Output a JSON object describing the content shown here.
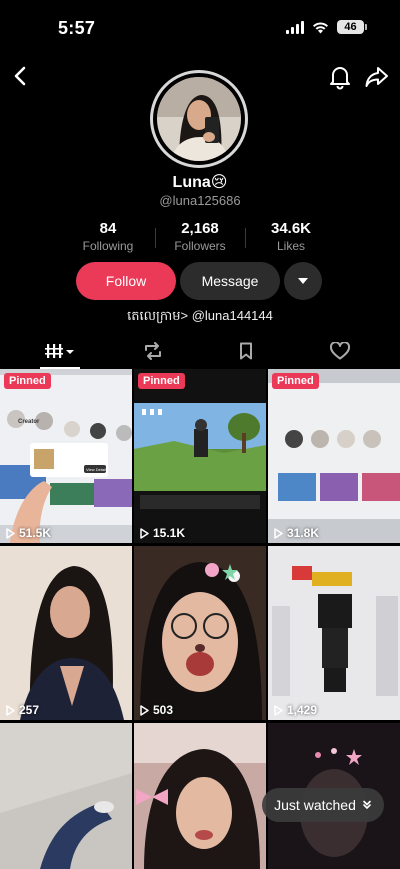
{
  "status_bar": {
    "time": "5:57",
    "battery": "46"
  },
  "profile": {
    "display_name": "Luna😢",
    "username": "@luna125686",
    "stats": [
      {
        "value": "84",
        "label": "Following"
      },
      {
        "value": "2,168",
        "label": "Followers"
      },
      {
        "value": "34.6K",
        "label": "Likes"
      }
    ],
    "follow_label": "Follow",
    "message_label": "Message",
    "bio": "តេលេក្រាម> @luna144144"
  },
  "tabs": [
    {
      "icon": "videos-grid-icon"
    },
    {
      "icon": "repost-icon"
    },
    {
      "icon": "bookmark-icon"
    },
    {
      "icon": "liked-heart-icon"
    }
  ],
  "videos": [
    {
      "pinned_label": "Pinned",
      "views": "51.5K"
    },
    {
      "pinned_label": "Pinned",
      "views": "15.1K"
    },
    {
      "pinned_label": "Pinned",
      "views": "31.8K"
    },
    {
      "views": "257"
    },
    {
      "views": "503"
    },
    {
      "views": "1,429"
    },
    {
      "views": ""
    },
    {
      "views": ""
    },
    {
      "views": ""
    }
  ],
  "video_1_overlay": {
    "notification_button": "View Details",
    "word": "Creator"
  },
  "just_watched_label": "Just watched",
  "colors": {
    "accent": "#ea3a57",
    "background": "#000000",
    "secondary_button": "#2c2c2c",
    "muted_text": "#9a9a9a"
  }
}
